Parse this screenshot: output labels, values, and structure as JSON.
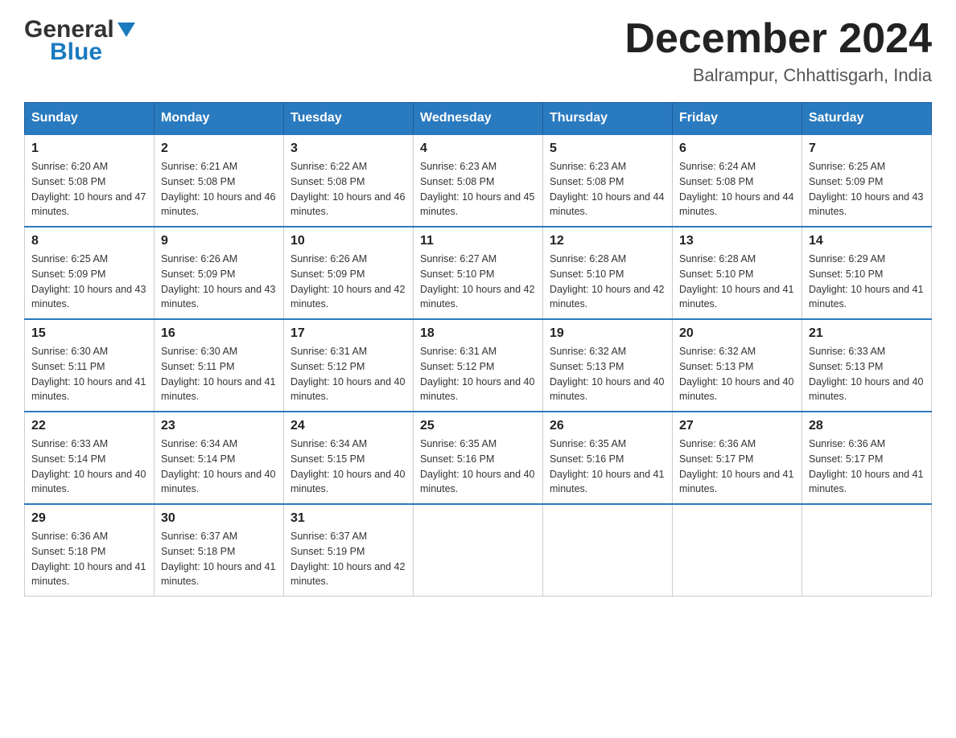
{
  "header": {
    "logo_general": "General",
    "logo_blue": "Blue",
    "month_title": "December 2024",
    "location": "Balrampur, Chhattisgarh, India"
  },
  "days_of_week": [
    "Sunday",
    "Monday",
    "Tuesday",
    "Wednesday",
    "Thursday",
    "Friday",
    "Saturday"
  ],
  "weeks": [
    [
      {
        "day": "1",
        "sunrise": "6:20 AM",
        "sunset": "5:08 PM",
        "daylight": "10 hours and 47 minutes."
      },
      {
        "day": "2",
        "sunrise": "6:21 AM",
        "sunset": "5:08 PM",
        "daylight": "10 hours and 46 minutes."
      },
      {
        "day": "3",
        "sunrise": "6:22 AM",
        "sunset": "5:08 PM",
        "daylight": "10 hours and 46 minutes."
      },
      {
        "day": "4",
        "sunrise": "6:23 AM",
        "sunset": "5:08 PM",
        "daylight": "10 hours and 45 minutes."
      },
      {
        "day": "5",
        "sunrise": "6:23 AM",
        "sunset": "5:08 PM",
        "daylight": "10 hours and 44 minutes."
      },
      {
        "day": "6",
        "sunrise": "6:24 AM",
        "sunset": "5:08 PM",
        "daylight": "10 hours and 44 minutes."
      },
      {
        "day": "7",
        "sunrise": "6:25 AM",
        "sunset": "5:09 PM",
        "daylight": "10 hours and 43 minutes."
      }
    ],
    [
      {
        "day": "8",
        "sunrise": "6:25 AM",
        "sunset": "5:09 PM",
        "daylight": "10 hours and 43 minutes."
      },
      {
        "day": "9",
        "sunrise": "6:26 AM",
        "sunset": "5:09 PM",
        "daylight": "10 hours and 43 minutes."
      },
      {
        "day": "10",
        "sunrise": "6:26 AM",
        "sunset": "5:09 PM",
        "daylight": "10 hours and 42 minutes."
      },
      {
        "day": "11",
        "sunrise": "6:27 AM",
        "sunset": "5:10 PM",
        "daylight": "10 hours and 42 minutes."
      },
      {
        "day": "12",
        "sunrise": "6:28 AM",
        "sunset": "5:10 PM",
        "daylight": "10 hours and 42 minutes."
      },
      {
        "day": "13",
        "sunrise": "6:28 AM",
        "sunset": "5:10 PM",
        "daylight": "10 hours and 41 minutes."
      },
      {
        "day": "14",
        "sunrise": "6:29 AM",
        "sunset": "5:10 PM",
        "daylight": "10 hours and 41 minutes."
      }
    ],
    [
      {
        "day": "15",
        "sunrise": "6:30 AM",
        "sunset": "5:11 PM",
        "daylight": "10 hours and 41 minutes."
      },
      {
        "day": "16",
        "sunrise": "6:30 AM",
        "sunset": "5:11 PM",
        "daylight": "10 hours and 41 minutes."
      },
      {
        "day": "17",
        "sunrise": "6:31 AM",
        "sunset": "5:12 PM",
        "daylight": "10 hours and 40 minutes."
      },
      {
        "day": "18",
        "sunrise": "6:31 AM",
        "sunset": "5:12 PM",
        "daylight": "10 hours and 40 minutes."
      },
      {
        "day": "19",
        "sunrise": "6:32 AM",
        "sunset": "5:13 PM",
        "daylight": "10 hours and 40 minutes."
      },
      {
        "day": "20",
        "sunrise": "6:32 AM",
        "sunset": "5:13 PM",
        "daylight": "10 hours and 40 minutes."
      },
      {
        "day": "21",
        "sunrise": "6:33 AM",
        "sunset": "5:13 PM",
        "daylight": "10 hours and 40 minutes."
      }
    ],
    [
      {
        "day": "22",
        "sunrise": "6:33 AM",
        "sunset": "5:14 PM",
        "daylight": "10 hours and 40 minutes."
      },
      {
        "day": "23",
        "sunrise": "6:34 AM",
        "sunset": "5:14 PM",
        "daylight": "10 hours and 40 minutes."
      },
      {
        "day": "24",
        "sunrise": "6:34 AM",
        "sunset": "5:15 PM",
        "daylight": "10 hours and 40 minutes."
      },
      {
        "day": "25",
        "sunrise": "6:35 AM",
        "sunset": "5:16 PM",
        "daylight": "10 hours and 40 minutes."
      },
      {
        "day": "26",
        "sunrise": "6:35 AM",
        "sunset": "5:16 PM",
        "daylight": "10 hours and 41 minutes."
      },
      {
        "day": "27",
        "sunrise": "6:36 AM",
        "sunset": "5:17 PM",
        "daylight": "10 hours and 41 minutes."
      },
      {
        "day": "28",
        "sunrise": "6:36 AM",
        "sunset": "5:17 PM",
        "daylight": "10 hours and 41 minutes."
      }
    ],
    [
      {
        "day": "29",
        "sunrise": "6:36 AM",
        "sunset": "5:18 PM",
        "daylight": "10 hours and 41 minutes."
      },
      {
        "day": "30",
        "sunrise": "6:37 AM",
        "sunset": "5:18 PM",
        "daylight": "10 hours and 41 minutes."
      },
      {
        "day": "31",
        "sunrise": "6:37 AM",
        "sunset": "5:19 PM",
        "daylight": "10 hours and 42 minutes."
      },
      null,
      null,
      null,
      null
    ]
  ]
}
